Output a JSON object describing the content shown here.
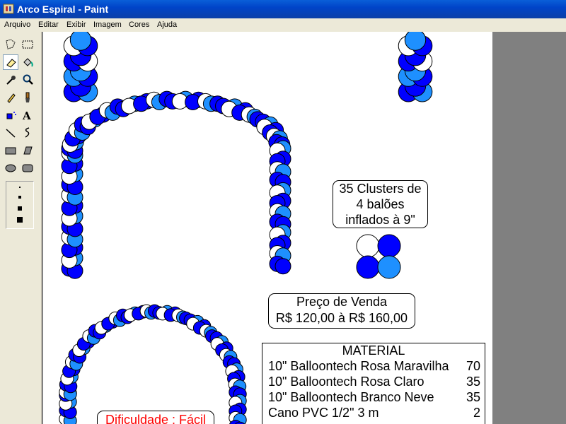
{
  "window": {
    "title": "Arco Espiral - Paint"
  },
  "menu": [
    "Arquivo",
    "Editar",
    "Exibir",
    "Imagem",
    "Cores",
    "Ajuda"
  ],
  "tools": [
    "free-form-select",
    "rect-select",
    "eraser",
    "fill",
    "color-picker",
    "magnifier",
    "pencil",
    "brush",
    "airbrush",
    "text",
    "line",
    "curve",
    "rectangle",
    "polygon",
    "ellipse",
    "rounded-rect"
  ],
  "colors": {
    "blue": "#0000ff",
    "light_blue": "#1e90ff",
    "white": "#ffffff",
    "title_blue": "#0a4bd0",
    "red": "#ff0000"
  },
  "canvas": {
    "clusters_box": {
      "line1": "35 Clusters de",
      "line2": "4 balões",
      "line3": "inflados à 9\""
    },
    "price_box": {
      "line1": "Preço de Venda",
      "line2": "R$ 120,00 à R$ 160,00"
    },
    "material": {
      "header": "MATERIAL",
      "items": [
        {
          "name": "10\" Balloontech Rosa Maravilha",
          "qty": "70"
        },
        {
          "name": "10\" Balloontech Rosa Claro",
          "qty": "35"
        },
        {
          "name": "10\" Balloontech Branco Neve",
          "qty": "35"
        },
        {
          "name": "Cano PVC 1/2\" 3 m",
          "qty": "2"
        }
      ]
    },
    "difficulty": "Dificuldade : Fácil"
  }
}
